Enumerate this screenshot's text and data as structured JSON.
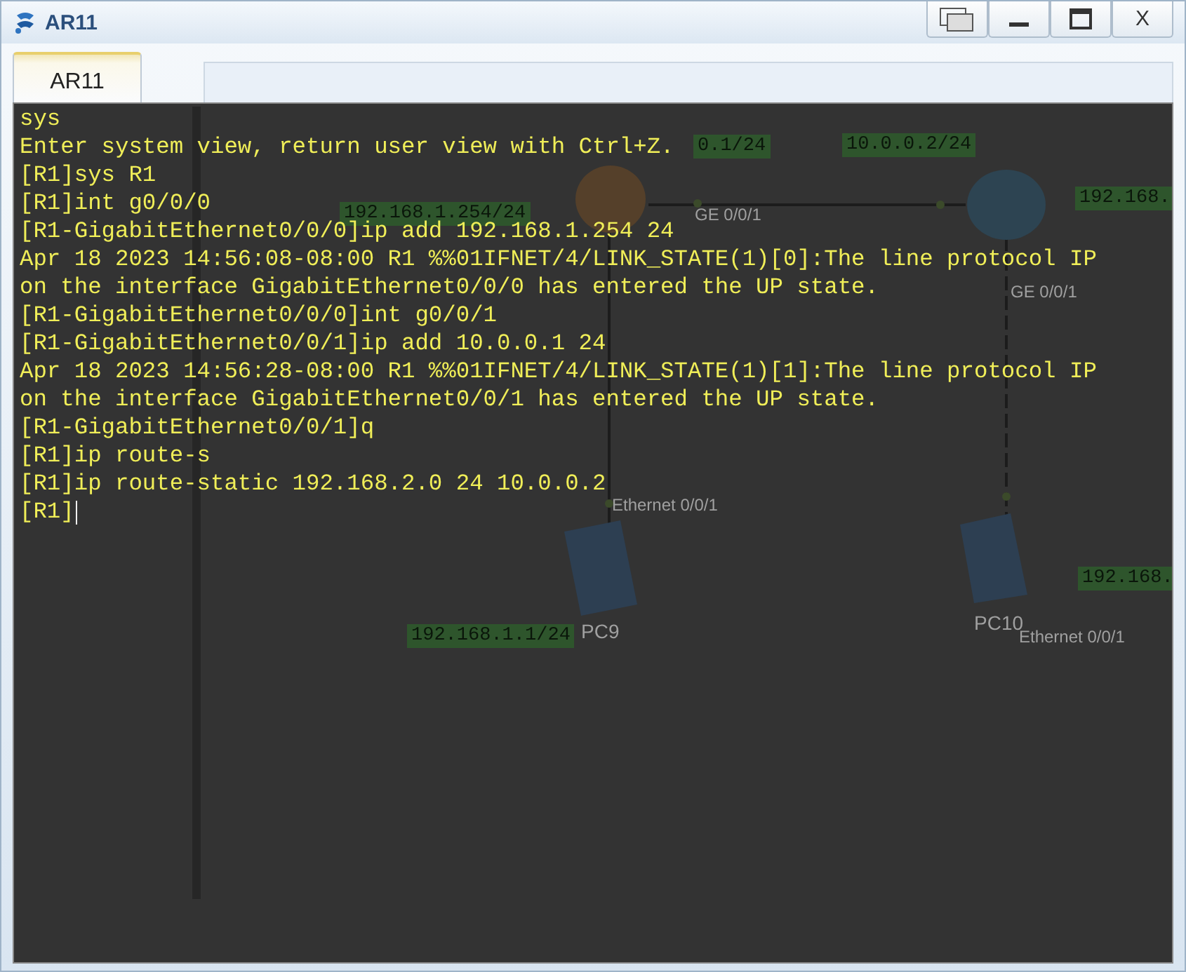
{
  "window": {
    "title": "AR11",
    "close_label": "X"
  },
  "tabs": [
    {
      "label": "AR11",
      "selected": true
    }
  ],
  "topology": {
    "labels": [
      {
        "kind": "address",
        "text": "0.1/24"
      },
      {
        "kind": "address",
        "text": "10.0.0.2/24"
      },
      {
        "kind": "address",
        "text": "192.168.1.254/24"
      },
      {
        "kind": "address",
        "text": "192.168."
      },
      {
        "kind": "port",
        "text": "GE 0/0/1"
      },
      {
        "kind": "port",
        "text": "GE 0/0/1"
      },
      {
        "kind": "port",
        "text": "Ethernet 0/0/1"
      },
      {
        "kind": "address",
        "text": "192.168.1.1/24"
      },
      {
        "kind": "device",
        "text": "PC9"
      },
      {
        "kind": "device",
        "text": "PC10"
      },
      {
        "kind": "address",
        "text": "192.168."
      },
      {
        "kind": "port",
        "text": "Ethernet 0/0/1"
      }
    ]
  },
  "terminal": {
    "lines": [
      "sys",
      "Enter system view, return user view with Ctrl+Z.",
      "[R1]sys R1",
      "[R1]int g0/0/0",
      "[R1-GigabitEthernet0/0/0]ip add 192.168.1.254 24",
      "Apr 18 2023 14:56:08-08:00 R1 %%01IFNET/4/LINK_STATE(1)[0]:The line protocol IP",
      "on the interface GigabitEthernet0/0/0 has entered the UP state.",
      "[R1-GigabitEthernet0/0/0]int g0/0/1",
      "[R1-GigabitEthernet0/0/1]ip add 10.0.0.1 24",
      "Apr 18 2023 14:56:28-08:00 R1 %%01IFNET/4/LINK_STATE(1)[1]:The line protocol IP",
      "on the interface GigabitEthernet0/0/1 has entered the UP state.",
      "[R1-GigabitEthernet0/0/1]q",
      "[R1]ip route-s",
      "[R1]ip route-static 192.168.2.0 24 10.0.0.2",
      "[R1]"
    ]
  }
}
